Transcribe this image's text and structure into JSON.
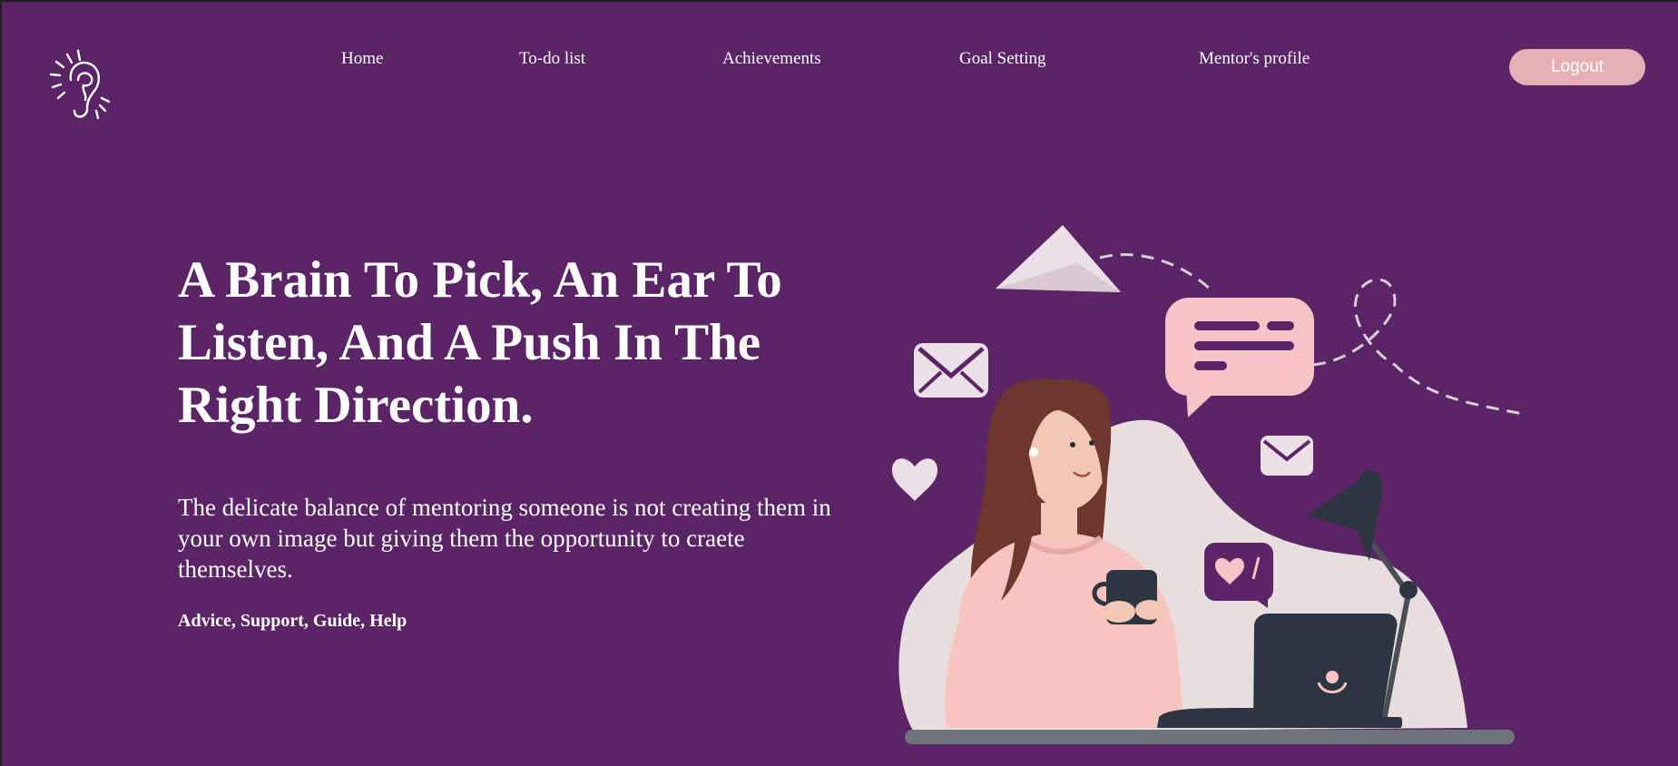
{
  "header": {
    "logo_icon": "ear-icon",
    "nav": [
      {
        "label": "Home"
      },
      {
        "label": "To-do list"
      },
      {
        "label": "Achievements"
      },
      {
        "label": "Goal Setting"
      },
      {
        "label": "Mentor's profile"
      }
    ],
    "logout_label": "Logout"
  },
  "hero": {
    "headline": "A Brain To Pick, An Ear To Listen, And A Push In The Right Direction.",
    "lead": "The delicate balance of mentoring someone is not creating them in your own image but giving them the opportunity to craete themselves.",
    "tagline": "Advice, Support, Guide, Help",
    "illustration_icon": "woman-with-laptop-illustration"
  },
  "colors": {
    "background": "#5a2466",
    "logout_button": "#e4b0b5",
    "text": "#ffffff"
  }
}
